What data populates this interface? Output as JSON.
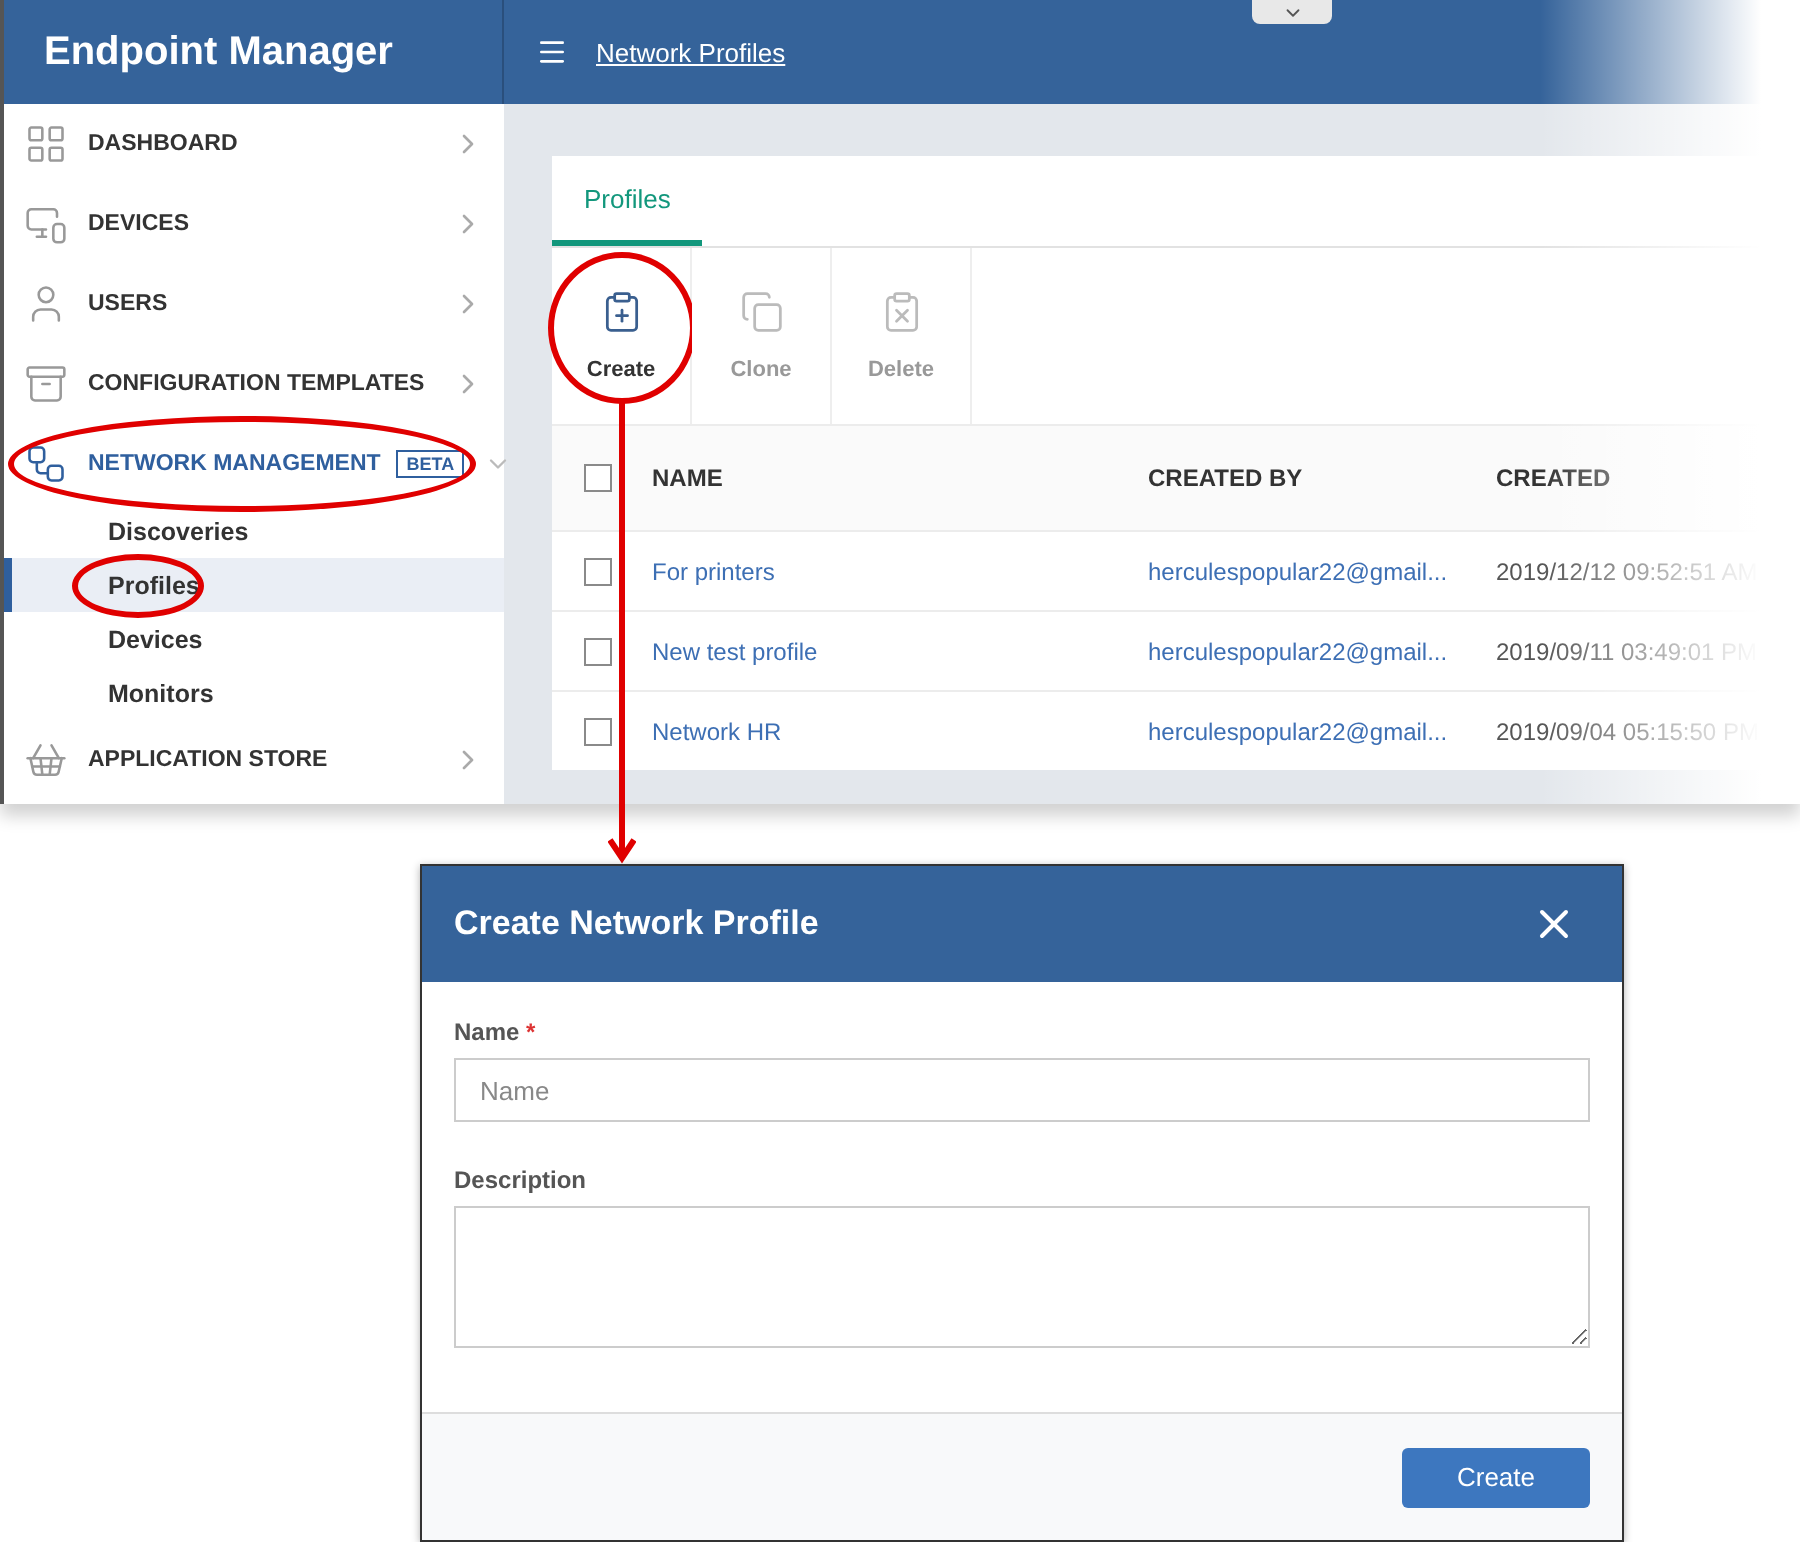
{
  "sidebar": {
    "title": "Endpoint Manager",
    "items": [
      {
        "kind": "grid",
        "label": "DASHBOARD",
        "expanded": false,
        "circled": false
      },
      {
        "kind": "devices",
        "label": "DEVICES",
        "expanded": false,
        "circled": false
      },
      {
        "kind": "user",
        "label": "USERS",
        "expanded": false,
        "circled": false
      },
      {
        "kind": "templates",
        "label": "CONFIGURATION TEMPLATES",
        "expanded": false,
        "circled": false
      },
      {
        "kind": "network",
        "label": "NETWORK MANAGEMENT",
        "badge": "BETA",
        "expanded": true,
        "circled": true,
        "children": [
          {
            "label": "Discoveries",
            "selected": false,
            "circled": false
          },
          {
            "label": "Profiles",
            "selected": true,
            "circled": true
          },
          {
            "label": "Devices",
            "selected": false,
            "circled": false
          },
          {
            "label": "Monitors",
            "selected": false,
            "circled": false
          }
        ]
      },
      {
        "kind": "store",
        "label": "APPLICATION STORE",
        "expanded": false,
        "circled": false
      }
    ]
  },
  "header": {
    "breadcrumb": "Network Profiles"
  },
  "tabs": [
    {
      "label": "Profiles",
      "selected": true
    }
  ],
  "toolbar": [
    {
      "kind": "create",
      "label": "Create",
      "disabled": false,
      "circled": true
    },
    {
      "kind": "clone",
      "label": "Clone",
      "disabled": true,
      "circled": false
    },
    {
      "kind": "delete",
      "label": "Delete",
      "disabled": true,
      "circled": false
    }
  ],
  "table": {
    "columns": [
      "NAME",
      "CREATED BY",
      "CREATED"
    ],
    "header_checked": false,
    "rows": [
      {
        "checked": false,
        "cells": [
          "For printers",
          "herculespopular22@gmail...",
          "2019/12/12 09:52:51 AM"
        ]
      },
      {
        "checked": false,
        "cells": [
          "New test profile",
          "herculespopular22@gmail...",
          "2019/09/11 03:49:01 PM"
        ]
      },
      {
        "checked": false,
        "cells": [
          "Network HR",
          "herculespopular22@gmail...",
          "2019/09/04 05:15:50 PM"
        ]
      }
    ]
  },
  "dialog": {
    "title": "Create Network Profile",
    "fields": [
      {
        "kind": "input",
        "label": "Name",
        "required_mark": "*",
        "placeholder": "Name"
      },
      {
        "kind": "textarea",
        "label": "Description"
      }
    ],
    "buttons": [
      "Create"
    ]
  }
}
